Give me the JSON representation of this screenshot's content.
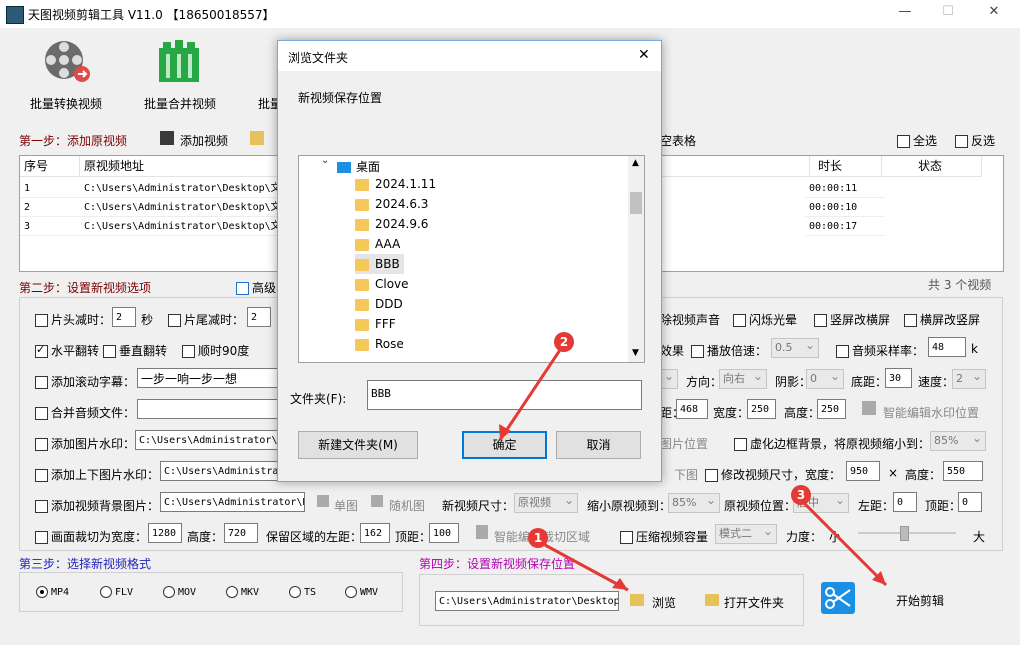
{
  "window": {
    "title": "天图视频剪辑工具 V11.0 【18650018557】"
  },
  "toolbar": {
    "batch_convert": "批量转换视频",
    "batch_merge": "批量合并视频",
    "batch_third": "批量"
  },
  "step1": {
    "label": "第一步：添加原视频",
    "add_video": "添加视频",
    "clear_table": "空表格",
    "select_all": "全选",
    "invert": "反选"
  },
  "table": {
    "headers": [
      "序号",
      "原视频地址",
      "时长",
      "状态"
    ],
    "rows": [
      {
        "idx": "1",
        "path": "C:\\Users\\Administrator\\Desktop\\文",
        "dur": "00:00:11",
        "status": ""
      },
      {
        "idx": "2",
        "path": "C:\\Users\\Administrator\\Desktop\\文",
        "dur": "00:00:10",
        "status": ""
      },
      {
        "idx": "3",
        "path": "C:\\Users\\Administrator\\Desktop\\文",
        "dur": "00:00:17",
        "status": ""
      }
    ],
    "count": "共 3 个视频"
  },
  "step2": {
    "label": "第二步：设置新视频选项",
    "advanced": "高级自",
    "head_trim": "片头减时：",
    "head_val": "2",
    "sec": "秒",
    "tail_trim": "片尾减时：",
    "tail_val": "2",
    "remove_audio": "除视频声音",
    "flash": "闪烁光晕",
    "v2h": "竖屏改横屏",
    "h2v": "横屏改竖屏",
    "hflip": "水平翻转",
    "vflip": "垂直翻转",
    "rot90": "顺时90度",
    "effect": "效果",
    "speed": "播放倍速：",
    "speed_val": "0.5",
    "sample": "音频采样率：",
    "sample_val": "48",
    "k": "k",
    "subtitle": "添加滚动字幕：",
    "subtitle_val": "一步一响一步一想",
    "direction": "方向：",
    "direction_val": "向右",
    "shadow": "阴影：",
    "shadow_val": "0",
    "bottom": "底距：",
    "bottom_val": "30",
    "speed2": "速度：",
    "speed2_val": "2",
    "merge_audio": "合并音频文件：",
    "dist": "距：",
    "dist_val": "468",
    "width": "宽度：",
    "width_val": "250",
    "height": "高度：",
    "height_val": "250",
    "smart_wm": "智能编辑水印位置",
    "img_wm": "添加图片水印：",
    "img_wm_path": "C:\\Users\\Administrator\\De",
    "img_pos": "图片位置",
    "blur_border": "虚化边框背景，将原视频缩小到：",
    "blur_val": "85%",
    "topbottom": "添加上下图片水印：",
    "topbottom_path": "C:\\Users\\Administrator\\D",
    "down_img": "下图",
    "resize": "修改视频尺寸，宽度：",
    "resize_w": "950",
    "times": "×",
    "resize_h_lbl": "高度：",
    "resize_h": "550",
    "bg_img": "添加视频背景图片：",
    "bg_img_path": "C:\\Users\\Administrator\\D",
    "single": "单图",
    "random": "随机图",
    "new_size": "新视频尺寸：",
    "new_size_val": "原视频",
    "shrink": "缩小原视频到：",
    "shrink_val": "85%",
    "pos": "原视频位置：",
    "pos_val": "居中",
    "left": "左距：",
    "left_val": "0",
    "top": "顶距：",
    "top_val": "0",
    "crop": "画面裁切为宽度：",
    "crop_w": "1280",
    "crop_h_lbl": "高度：",
    "crop_h": "720",
    "keep_left": "保留区域的左距：",
    "keep_left_val": "162",
    "keep_top": "顶距：",
    "keep_top_val": "100",
    "smart_crop": "智能编辑裁切区域",
    "compress": "压缩视频容量",
    "compress_val": "模式二",
    "force": "力度：",
    "small": "小",
    "big": "大"
  },
  "step3": {
    "label": "第三步：选择新视频格式",
    "formats": [
      "MP4",
      "FLV",
      "MOV",
      "MKV",
      "TS",
      "WMV"
    ]
  },
  "step4": {
    "label": "第四步：设置新视频保存位置",
    "path": "C:\\Users\\Administrator\\Desktop",
    "browse": "浏览",
    "open_folder": "打开文件夹",
    "start": "开始剪辑"
  },
  "dialog": {
    "title": "浏览文件夹",
    "prompt": "新视频保存位置",
    "root": "桌面",
    "folders": [
      "2024.1.11",
      "2024.6.3",
      "2024.9.6",
      "AAA",
      "BBB",
      "Clove",
      "DDD",
      "FFF",
      "Rose"
    ],
    "folder_label": "文件夹(F):",
    "folder_val": "BBB",
    "new_folder": "新建文件夹(M)",
    "ok": "确定",
    "cancel": "取消"
  },
  "annotations": [
    "1",
    "2",
    "3"
  ]
}
